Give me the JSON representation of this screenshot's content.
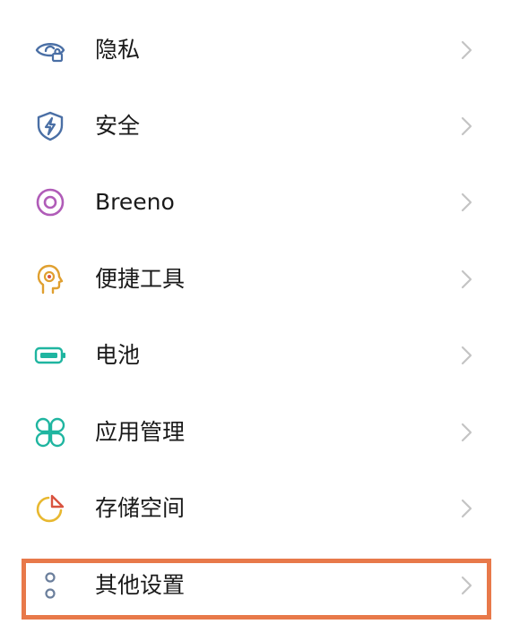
{
  "settings": {
    "items": [
      {
        "label": "隐私",
        "icon": "privacy-eye-lock-icon",
        "color": "#4a6fa5"
      },
      {
        "label": "安全",
        "icon": "security-shield-bolt-icon",
        "color": "#4a6fa5"
      },
      {
        "label": "Breeno",
        "icon": "breeno-ring-icon",
        "color": "#b05cb8"
      },
      {
        "label": "便捷工具",
        "icon": "head-target-icon",
        "color": "#e0a030"
      },
      {
        "label": "电池",
        "icon": "battery-icon",
        "color": "#1fb5a0"
      },
      {
        "label": "应用管理",
        "icon": "app-grid-icon",
        "color": "#1fb5a0"
      },
      {
        "label": "存储空间",
        "icon": "storage-pie-icon",
        "color": "#e8b830"
      },
      {
        "label": "其他设置",
        "icon": "more-dots-icon",
        "color": "#6b7f9c"
      }
    ]
  },
  "highlight": {
    "color": "#e8794a",
    "target": "其他设置"
  }
}
